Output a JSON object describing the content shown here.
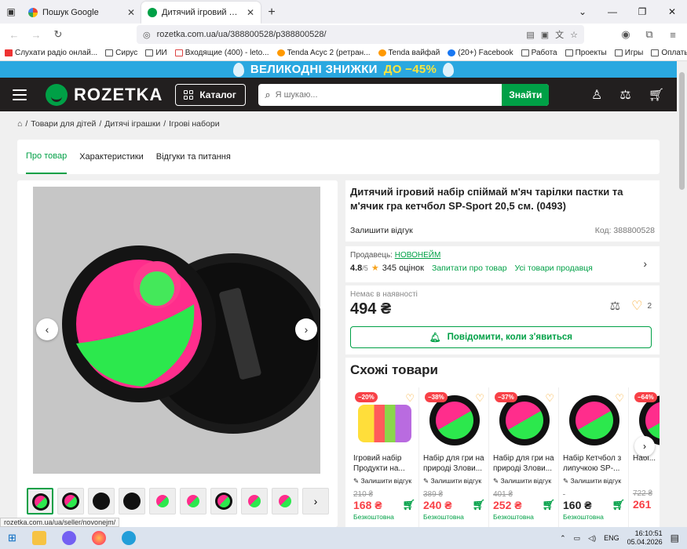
{
  "browser": {
    "tabs": [
      {
        "title": "Пошук Google",
        "active": false
      },
      {
        "title": "Дитячий ігровий набір спіймай",
        "active": true
      }
    ],
    "url": "rozetka.com.ua/ua/388800528/p388800528/",
    "bookmarks": [
      "Слухати радіо онлай...",
      "Сирус",
      "ИИ",
      "Входящие (400) - leto...",
      "Tenda Acyc 2 (ретран...",
      "Tenda вайфай",
      "(20+) Facebook",
      "Работа",
      "Проекты",
      "Игры",
      "Оплаты"
    ],
    "status_url": "rozetka.com.ua/ua/seller/novonejm/"
  },
  "promo": {
    "text": "ВЕЛИКОДНІ ЗНИЖКИ",
    "highlight": "ДО −45%"
  },
  "header": {
    "logo": "ROZETKA",
    "catalog": "Каталог",
    "search_placeholder": "Я шукаю...",
    "search_button": "Знайти"
  },
  "breadcrumb": [
    "Товари для дітей",
    "Дитячі іграшки",
    "Ігрові набори"
  ],
  "product_tabs": [
    "Про товар",
    "Характеристики",
    "Відгуки та питання"
  ],
  "product": {
    "title": "Дитячий ігровий набір спіймай м'яч тарілки пастки та м'ячик гра кетчбол SP-Sport 20,5 см. (0493)",
    "leave_review": "Залишити відгук",
    "code": "Код: 388800528",
    "seller_label": "Продавець:",
    "seller_name": "НОВОНЕЙМ",
    "rating": "4.8",
    "rating_max": "/5",
    "reviews": "345 оцінок",
    "ask_seller": "Запитати про товар",
    "all_seller": "Усі товари продавця",
    "availability": "Немає в наявності",
    "price": "494 ₴",
    "wish_count": "2",
    "notify": "Повідомити, коли з'явиться"
  },
  "similar": {
    "heading": "Схожі товари",
    "items": [
      {
        "badge": "−20%",
        "name": "Ігровий набір Продукти на...",
        "review": "Залишити відгук",
        "old": "210 ₴",
        "price": "168 ₴",
        "free": "Безкоштовна",
        "kind": "food"
      },
      {
        "badge": "−38%",
        "name": "Набір для гри на природі Злови...",
        "review": "Залишити відгук",
        "old": "389 ₴",
        "price": "240 ₴",
        "free": "Безкоштовна",
        "kind": "disc"
      },
      {
        "badge": "−37%",
        "name": "Набір для гри на природі Злови...",
        "review": "Залишити відгук",
        "old": "401 ₴",
        "price": "252 ₴",
        "free": "Безкоштовна",
        "kind": "disc"
      },
      {
        "badge": "",
        "name": "Набір Кетчбол з липучкою SP-...",
        "review": "Залишити відгук",
        "old": "",
        "price": "160 ₴",
        "free": "Безкоштовна",
        "kind": "disc"
      },
      {
        "badge": "−64%",
        "name": "Набі...",
        "review": "",
        "old": "722 ₴",
        "price": "261",
        "free": "",
        "kind": "disc"
      }
    ]
  },
  "taskbar": {
    "lang": "ENG",
    "time": "16:10:51",
    "date": "05.04.2026"
  },
  "colors": {
    "brand": "#00a046",
    "header": "#221f1f",
    "promo": "#2aa8e0",
    "sale": "#f84147"
  }
}
